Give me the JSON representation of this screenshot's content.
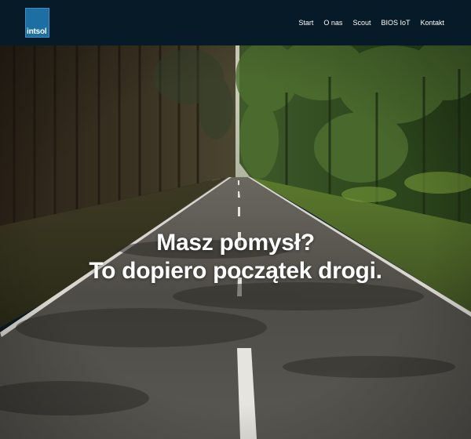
{
  "brand": {
    "logo_text": "intsol",
    "logo_color": "#1c6ea3"
  },
  "nav": {
    "items": [
      {
        "label": "Start"
      },
      {
        "label": "O nas"
      },
      {
        "label": "Scout"
      },
      {
        "label": "BIOS IoT"
      },
      {
        "label": "Kontakt"
      }
    ]
  },
  "hero": {
    "headline_line1": "Masz pomysł?",
    "headline_line2": "To dopiero początek drogi."
  },
  "colors": {
    "navbar": "#071a27",
    "text": "#ffffff"
  }
}
